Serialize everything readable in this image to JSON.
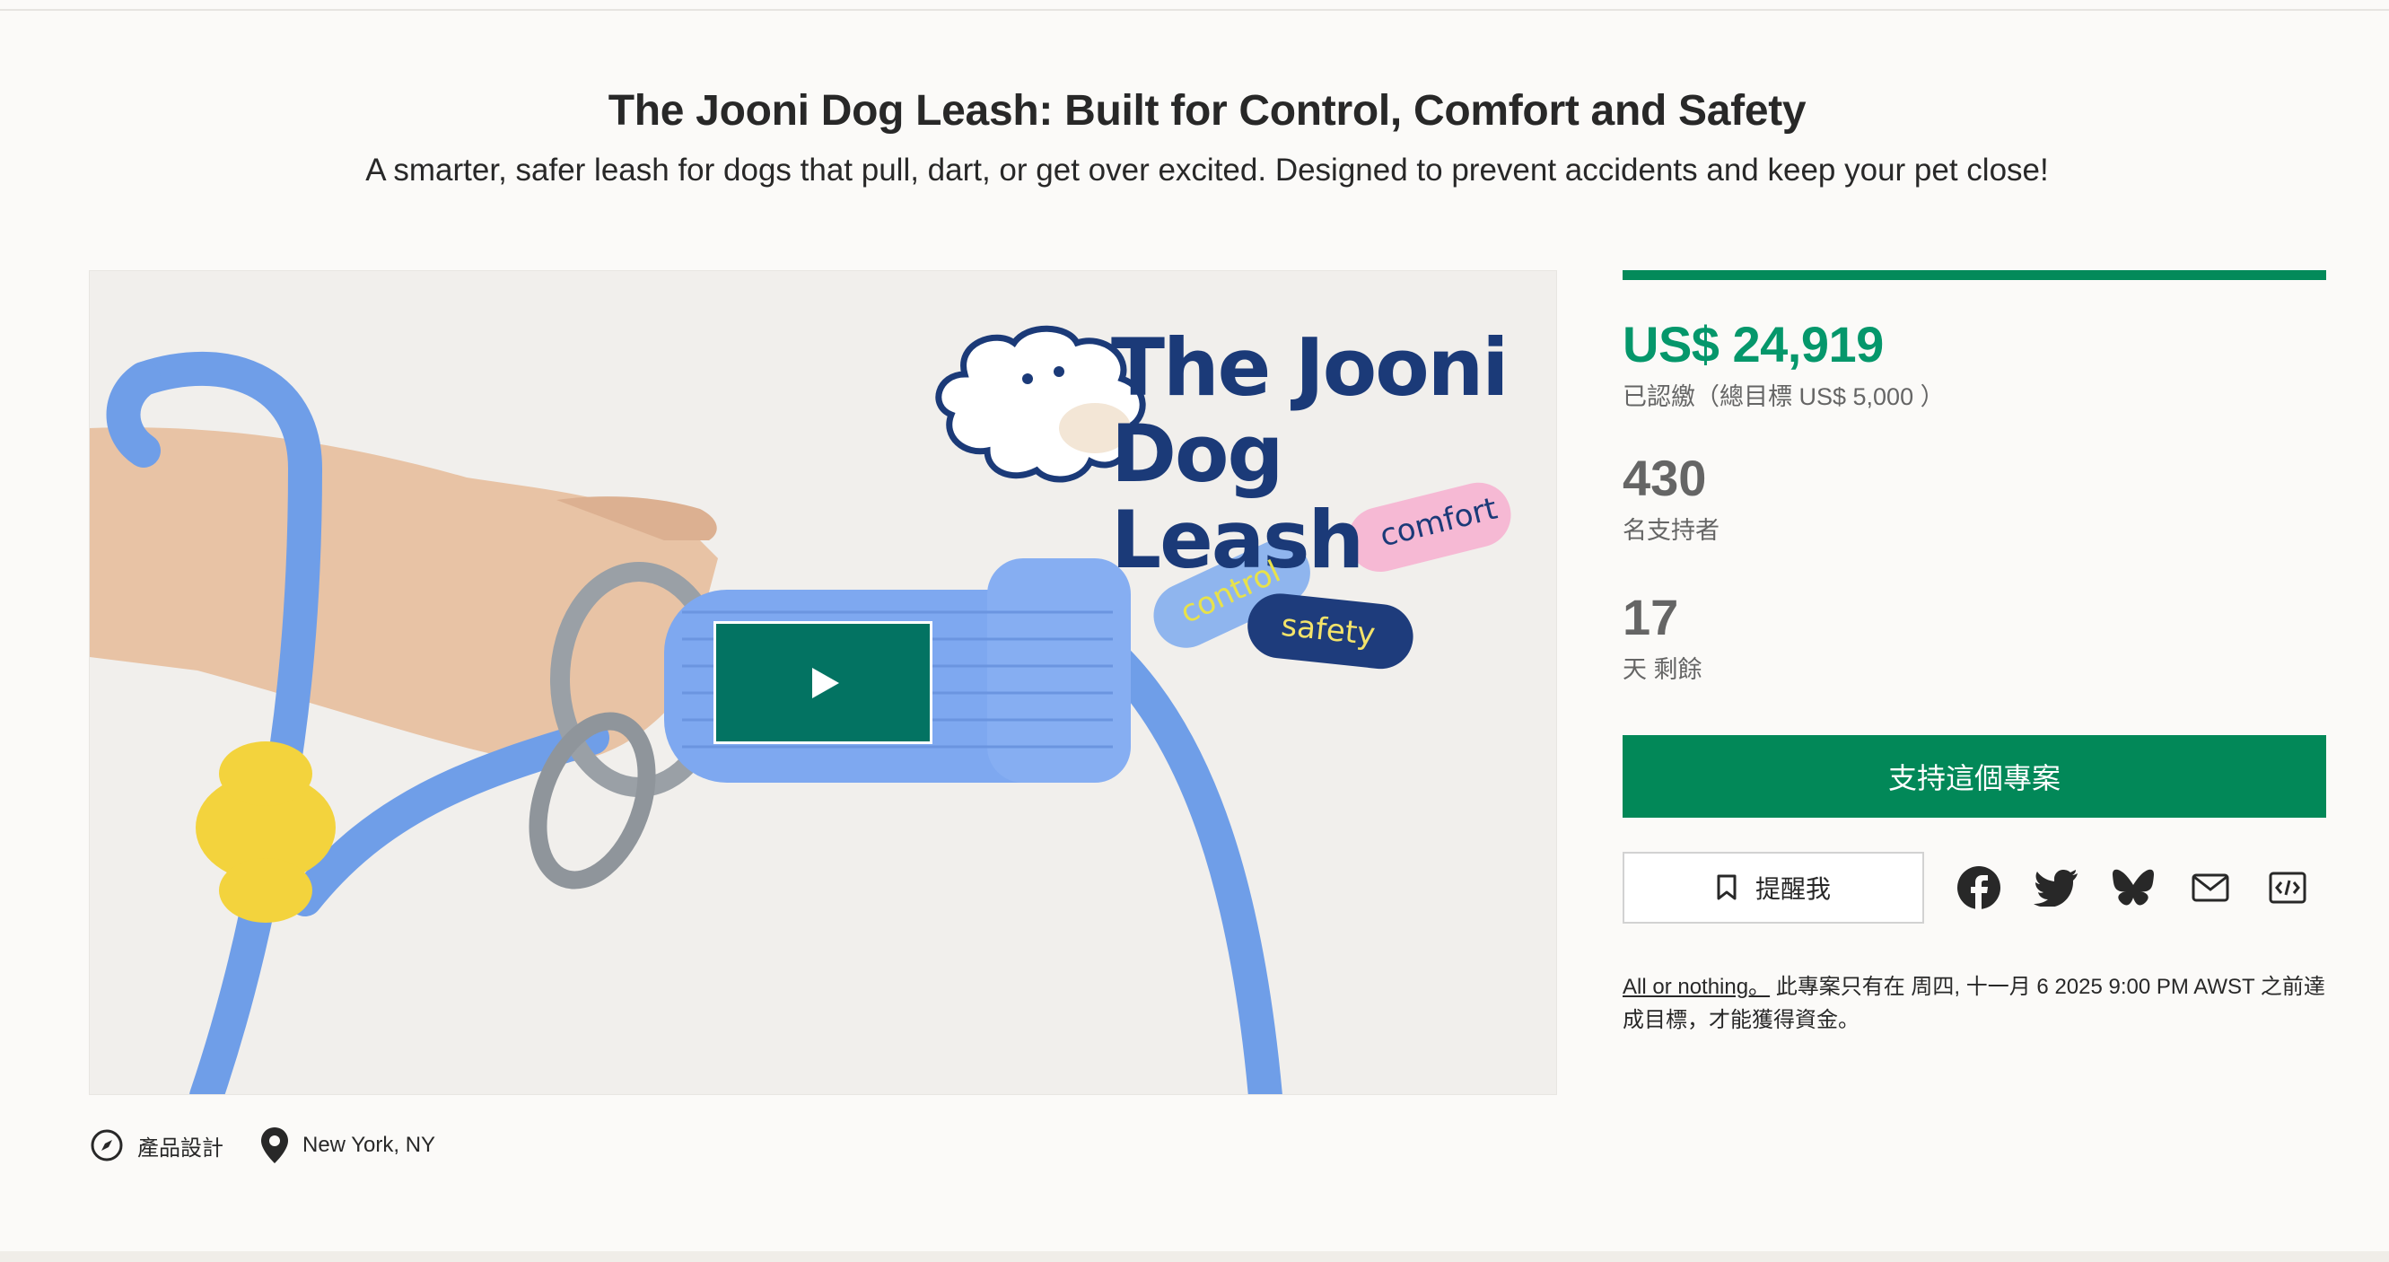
{
  "project": {
    "title": "The Jooni Dog Leash: Built for Control, Comfort and Safety",
    "subtitle": "A smarter, safer leash for dogs that pull, dart, or get over excited. Designed to prevent accidents and keep your pet close!"
  },
  "media": {
    "brand_line1": "The Jooni",
    "brand_line2": "Dog Leash",
    "tags": {
      "comfort": "comfort",
      "control": "control",
      "safety": "safety"
    }
  },
  "meta": {
    "category": "產品設計",
    "location": "New York, NY"
  },
  "funding": {
    "progress_fraction": 1.0,
    "pledged": "US$ 24,919",
    "pledged_label": "已認繳（總目標 US$ 5,000 ）",
    "backers": "430",
    "backers_label": "名支持者",
    "days": "17",
    "days_label": "天 剩餘"
  },
  "actions": {
    "back_label": "支持這個專案",
    "remind_label": "提醒我"
  },
  "fineprint": {
    "link": "All or nothing。",
    "text": " 此專案只有在 周四, 十一月 6 2025 9:00 PM AWST 之前達成目標，才能獲得資金。"
  },
  "colors": {
    "accent_green": "#05976b",
    "button_green": "#028858",
    "play_green": "#037362",
    "leash_blue": "#6f9ee8",
    "brand_navy": "#1b3a78"
  }
}
